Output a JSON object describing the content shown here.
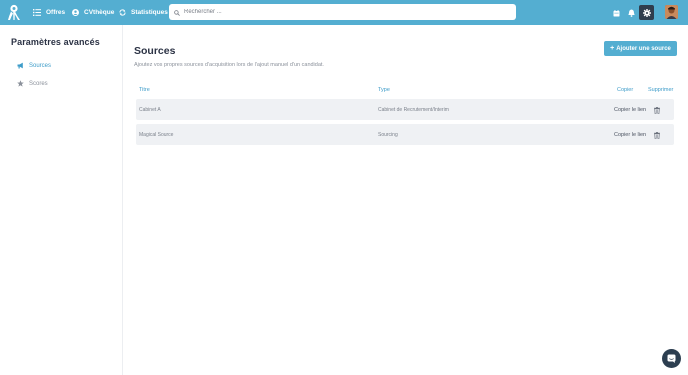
{
  "header": {
    "nav": [
      {
        "label": "Offres",
        "icon": "list-icon"
      },
      {
        "label": "CVthèque",
        "icon": "user-circle-icon"
      },
      {
        "label": "Statistiques",
        "icon": "refresh-icon"
      }
    ],
    "search": {
      "placeholder": "Rechercher ...",
      "value": ""
    },
    "icons": [
      "calendar-icon",
      "bell-icon",
      "gear-icon",
      "avatar"
    ]
  },
  "sidebar": {
    "title": "Paramètres avancés",
    "items": [
      {
        "label": "Sources",
        "icon": "megaphone-icon",
        "active": true
      },
      {
        "label": "Scores",
        "icon": "star-icon",
        "active": false
      }
    ]
  },
  "main": {
    "title": "Sources",
    "subtitle": "Ajoutez vos propres sources d'acquisition lors de l'ajout manuel d'un candidat.",
    "add_button": "Ajouter une source",
    "columns": {
      "title": "Titre",
      "type": "Type",
      "copy": "Copier",
      "delete": "Supprimer"
    },
    "rows": [
      {
        "title": "Cabinet A",
        "type": "Cabinet de Recrutement/Interim",
        "copy": "Copier le lien"
      },
      {
        "title": "Magical Source",
        "type": "Sourcing",
        "copy": "Copier le lien"
      }
    ]
  },
  "colors": {
    "brand": "#54aed1",
    "accent": "#3d9cc9",
    "dark": "#2f3d4d"
  }
}
